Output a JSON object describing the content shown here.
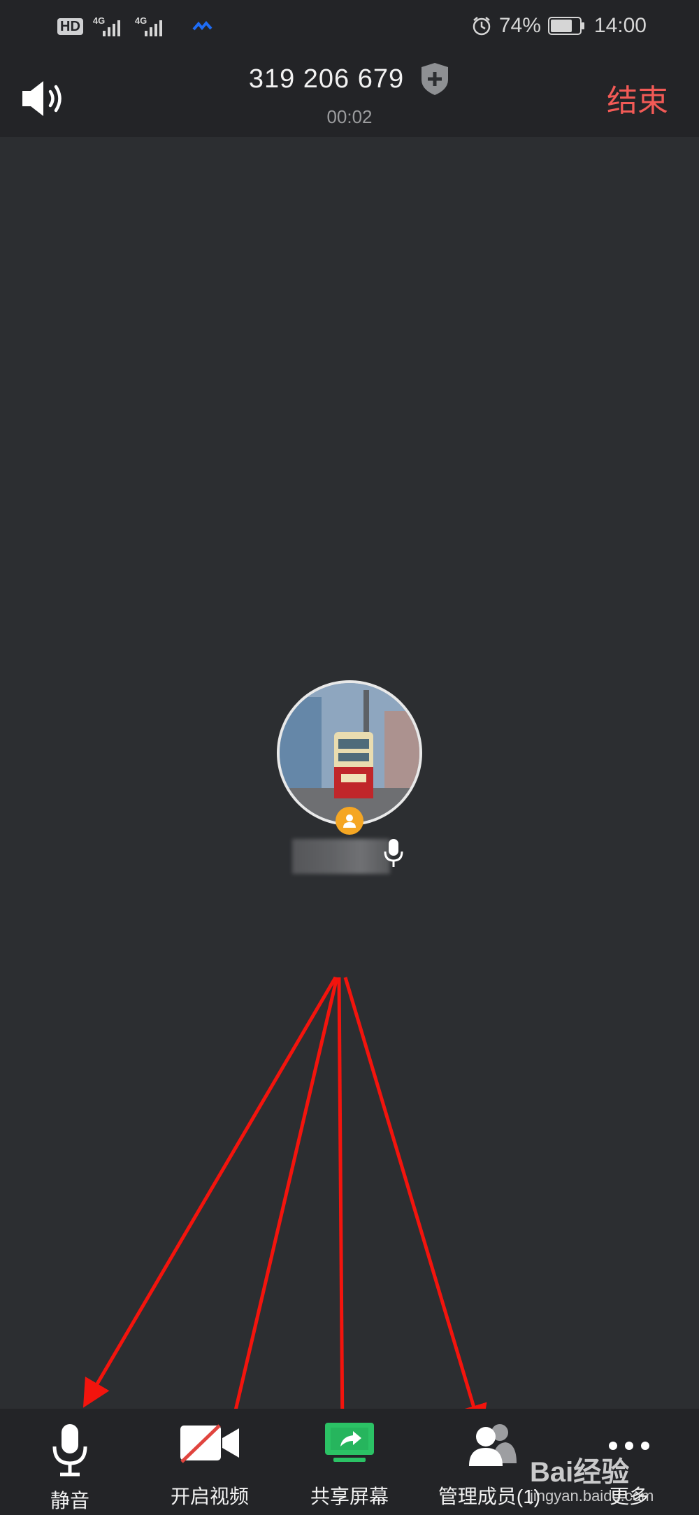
{
  "status_bar": {
    "hd": "HD",
    "network_label": "4G",
    "battery": "74%",
    "time": "14:00",
    "battery_level": 0.74
  },
  "header": {
    "meeting_id": "319 206 679",
    "timer": "00:02",
    "end_label": "结束"
  },
  "toolbar": {
    "items": [
      {
        "label": "静音",
        "icon": "microphone-icon"
      },
      {
        "label": "开启视频",
        "icon": "video-off-icon"
      },
      {
        "label": "共享屏幕",
        "icon": "share-screen-icon"
      },
      {
        "label": "管理成员(1)",
        "icon": "members-icon"
      },
      {
        "label": "更多",
        "icon": "more-icon"
      }
    ]
  },
  "watermark": {
    "brand": "Bai经验",
    "url": "jingyan.baidu.com"
  },
  "colors": {
    "end": "#f25a56",
    "share_green": "#2bc265",
    "badge": "#f5a623",
    "arrow": "#f3140d"
  }
}
